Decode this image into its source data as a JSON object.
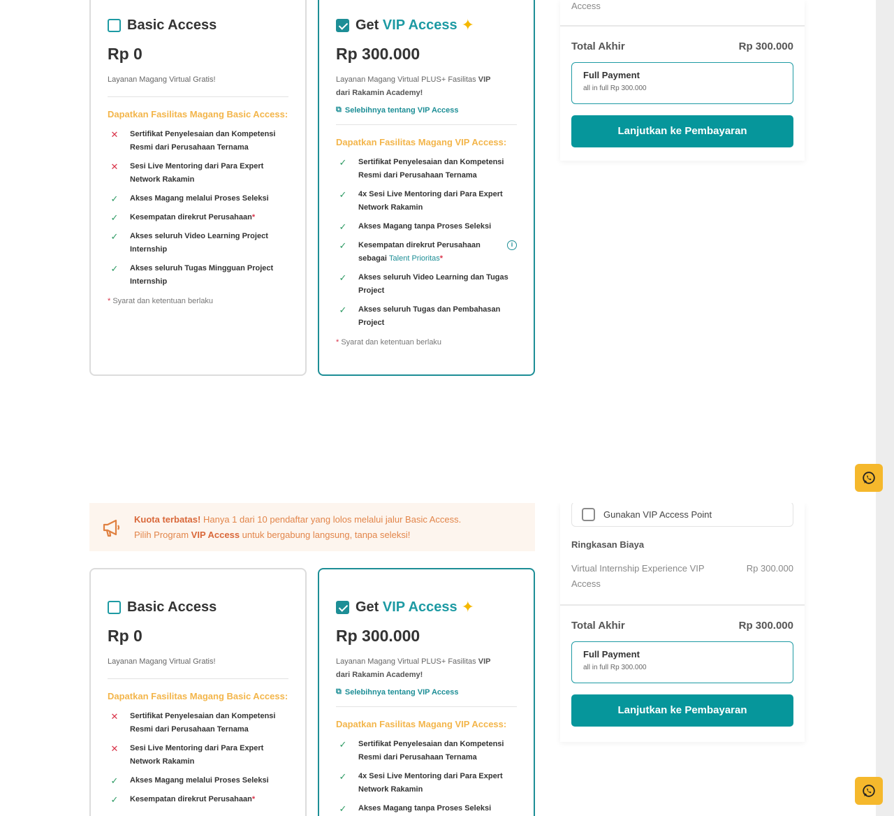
{
  "basic": {
    "title": "Basic Access",
    "price": "Rp 0",
    "desc": "Layanan Magang Virtual Gratis!",
    "features_title": "Dapatkan Fasilitas Magang Basic Access:",
    "features": [
      {
        "ok": false,
        "text": "Sertifikat Penyelesaian dan Kompetensi Resmi dari Perusahaan Ternama"
      },
      {
        "ok": false,
        "text": "Sesi Live Mentoring dari Para Expert Network Rakamin"
      },
      {
        "ok": true,
        "text": "Akses Magang melalui Proses Seleksi"
      },
      {
        "ok": true,
        "text": "Kesempatan direkrut Perusahaan"
      },
      {
        "ok": true,
        "text": "Akses seluruh Video Learning Project Internship"
      },
      {
        "ok": true,
        "text": "Akses seluruh Tugas Mingguan Project Internship"
      }
    ],
    "terms": "Syarat dan ketentuan berlaku",
    "asterisk": "*"
  },
  "vip": {
    "title_prefix": "Get",
    "title_highlight": "VIP Access",
    "price": "Rp 300.000",
    "desc_prefix": "Layanan Magang Virtual PLUS+ Fasilitas",
    "desc_bold1": "VIP",
    "desc_bold2": "dari Rakamin Academy!",
    "link": "Selebihnya tentang VIP Access",
    "features_title": "Dapatkan Fasilitas Magang VIP Access:",
    "features": [
      {
        "text": "Sertifikat Penyelesaian dan Kompetensi Resmi dari Perusahaan Ternama"
      },
      {
        "text": "4x Sesi Live Mentoring dari Para Expert Network Rakamin"
      },
      {
        "text": "Akses Magang tanpa Proses Seleksi"
      },
      {
        "text": "Akses seluruh Video Learning dan Tugas Project"
      },
      {
        "text": "Akses seluruh Tugas dan Pembahasan Project"
      }
    ],
    "talent_prefix": "Kesempatan direkrut Perusahaan sebagai",
    "talent_link": "Talent Prioritas",
    "terms": "Syarat dan ketentuan berlaku"
  },
  "summary": {
    "top_partial": "Access",
    "total_label": "Total Akhir",
    "total_value": "Rp 300.000",
    "pay_title": "Full Payment",
    "pay_sub": "all in full Rp 300.000",
    "cta": "Lanjutkan ke Pembayaran",
    "vip_point": "Gunakan VIP Access Point",
    "ringkasan": "Ringkasan Biaya",
    "item_name": "Virtual Internship Experience VIP Access",
    "item_price": "Rp 300.000"
  },
  "promo": {
    "bold1": "Kuota terbatas!",
    "text1": "Hanya 1 dari 10 pendaftar yang lolos melalui jalur Basic Access.",
    "text2a": "Pilih Program",
    "bold2": "VIP Access",
    "text2b": "untuk bergabung langsung, tanpa seleksi!"
  },
  "colors": {
    "teal": "#1d8e96",
    "orange": "#f3b54a",
    "whatsapp_button": "#f5b82c"
  },
  "icons": [
    "check-icon",
    "cross-icon",
    "external-link-icon",
    "info-icon",
    "megaphone-icon",
    "whatsapp-icon",
    "sparkle-icon"
  ]
}
